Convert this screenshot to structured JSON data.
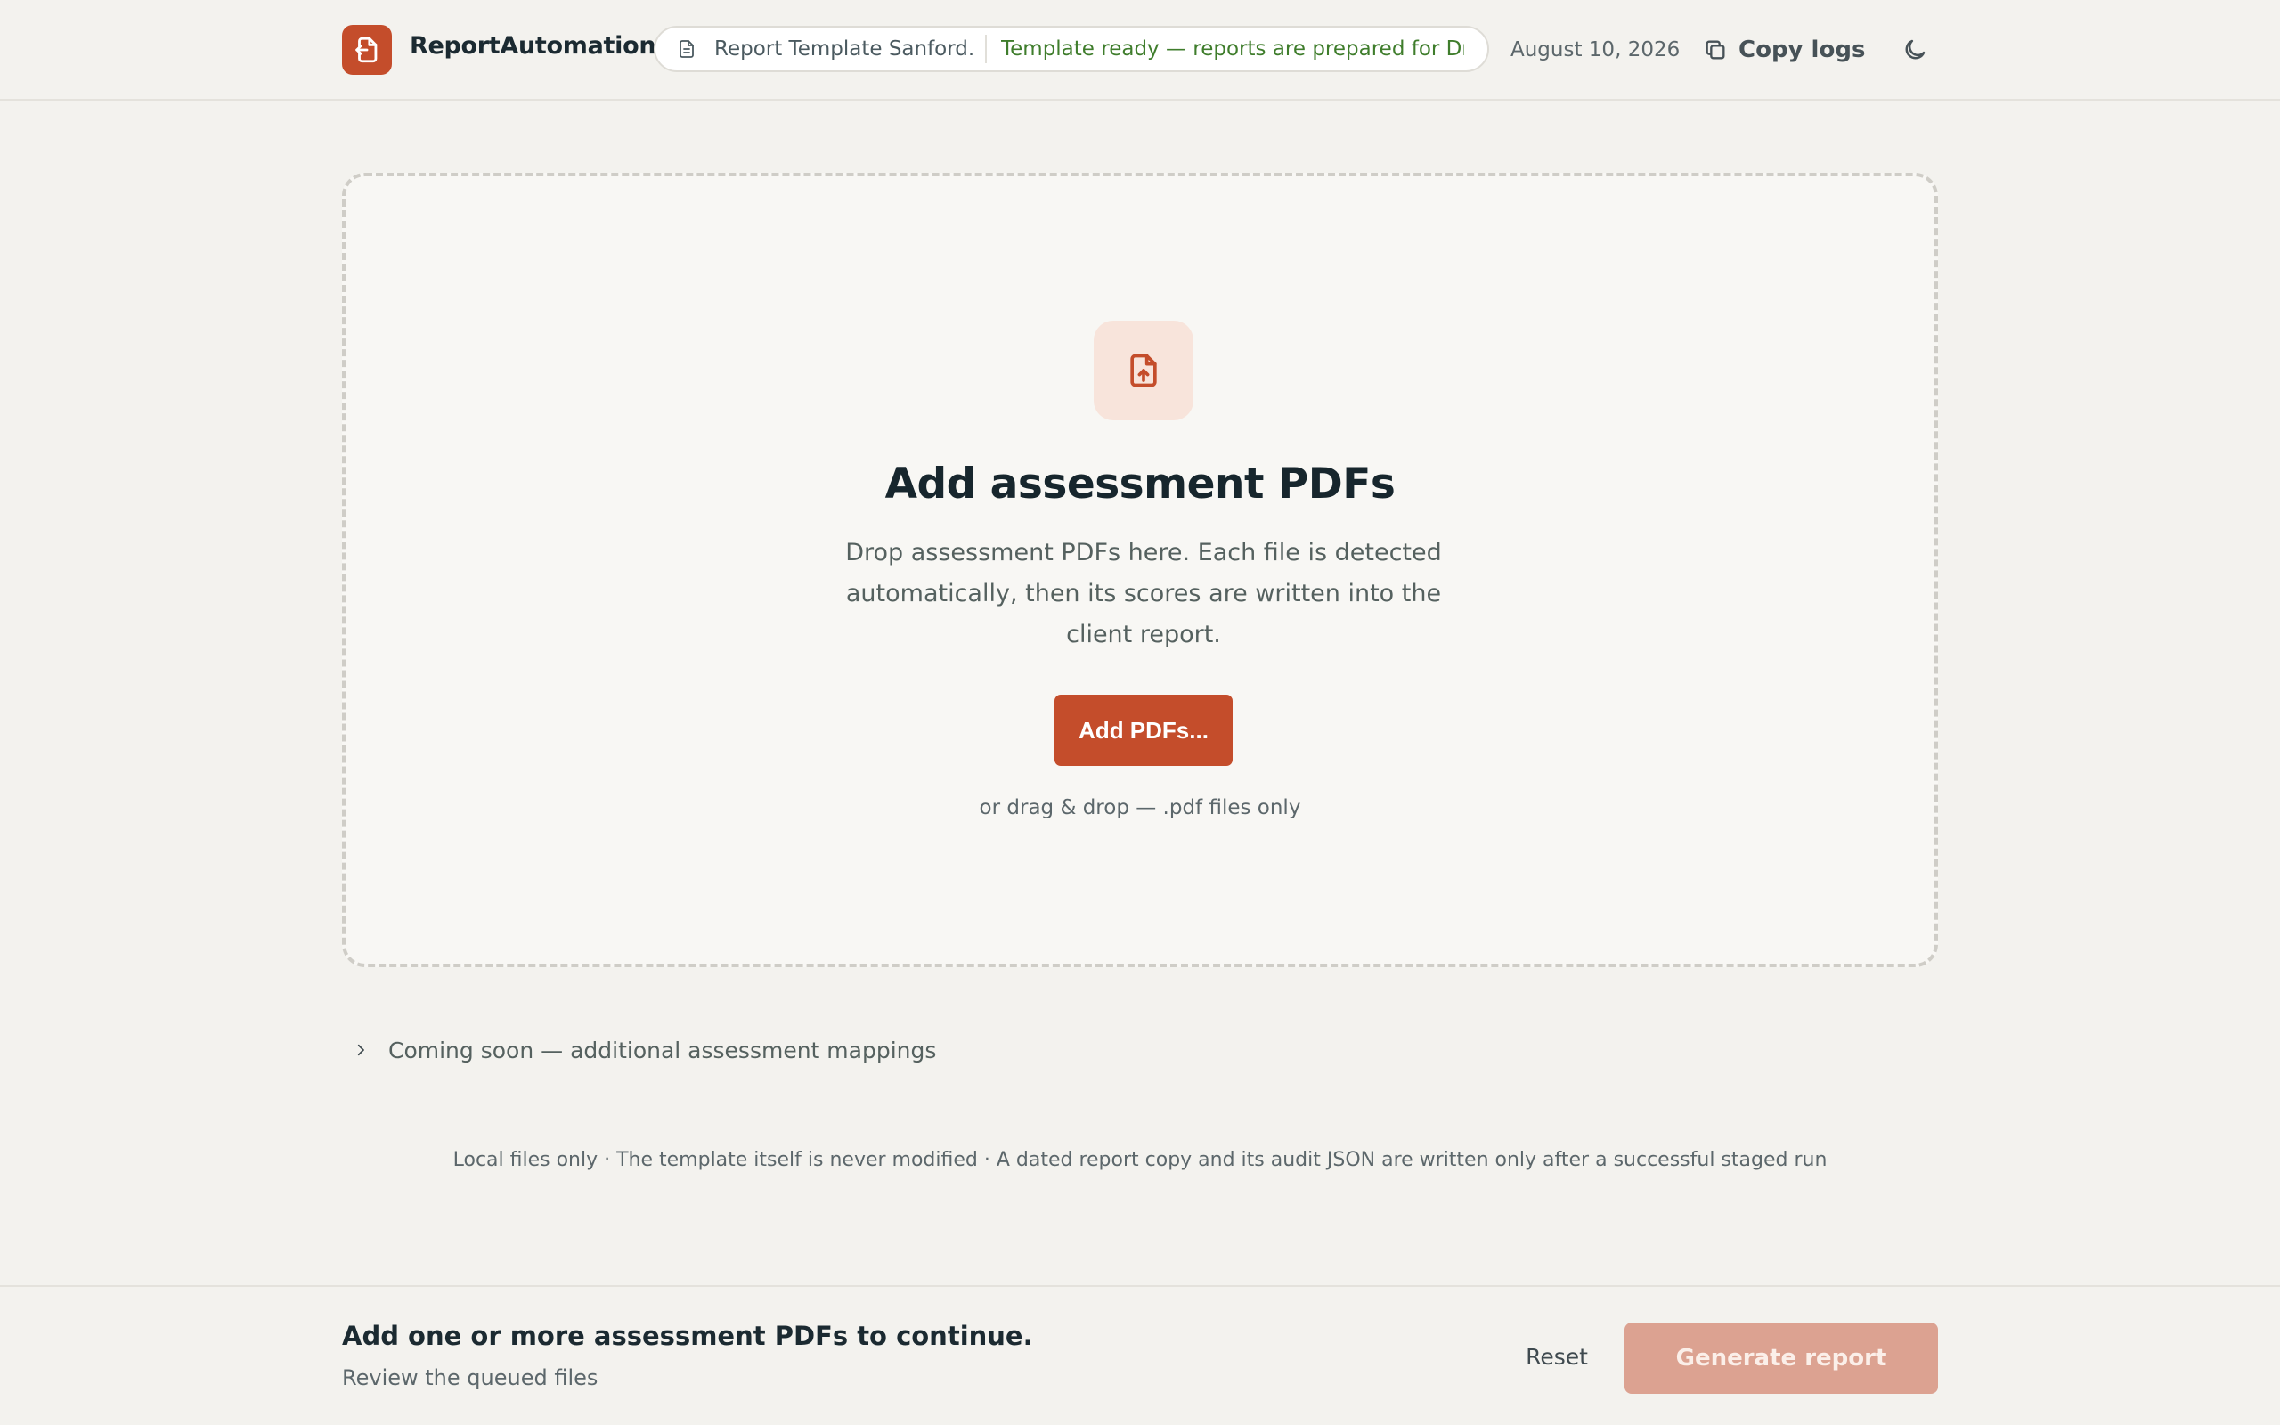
{
  "app": {
    "name": "ReportAutomation",
    "accent_color": "#c44d2b"
  },
  "header": {
    "template_name": "Report Template Sanford....",
    "template_status": "Template ready — reports are prepared for Dr. ...",
    "date": "August 10, 2026",
    "copy_logs_label": "Copy logs",
    "copy_icon": "copy-icon",
    "theme_icon": "moon-icon"
  },
  "dropzone": {
    "icon": "file-upload-icon",
    "title": "Add assessment PDFs",
    "description": "Drop assessment PDFs here. Each file is detected automatically, then its scores are written into the client report.",
    "button_label": "Add PDFs...",
    "hint": "or drag & drop — .pdf files only"
  },
  "coming_soon": {
    "icon": "chevron-right-icon",
    "label": "Coming soon — additional assessment mappings"
  },
  "footnote": "Local files only · The template itself is never modified · A dated report copy and its audit JSON are written only after a successful staged run",
  "footer": {
    "title": "Add one or more assessment PDFs to continue.",
    "subtitle": "Review the queued files",
    "reset_label": "Reset",
    "generate_label": "Generate report",
    "generate_enabled": false
  }
}
